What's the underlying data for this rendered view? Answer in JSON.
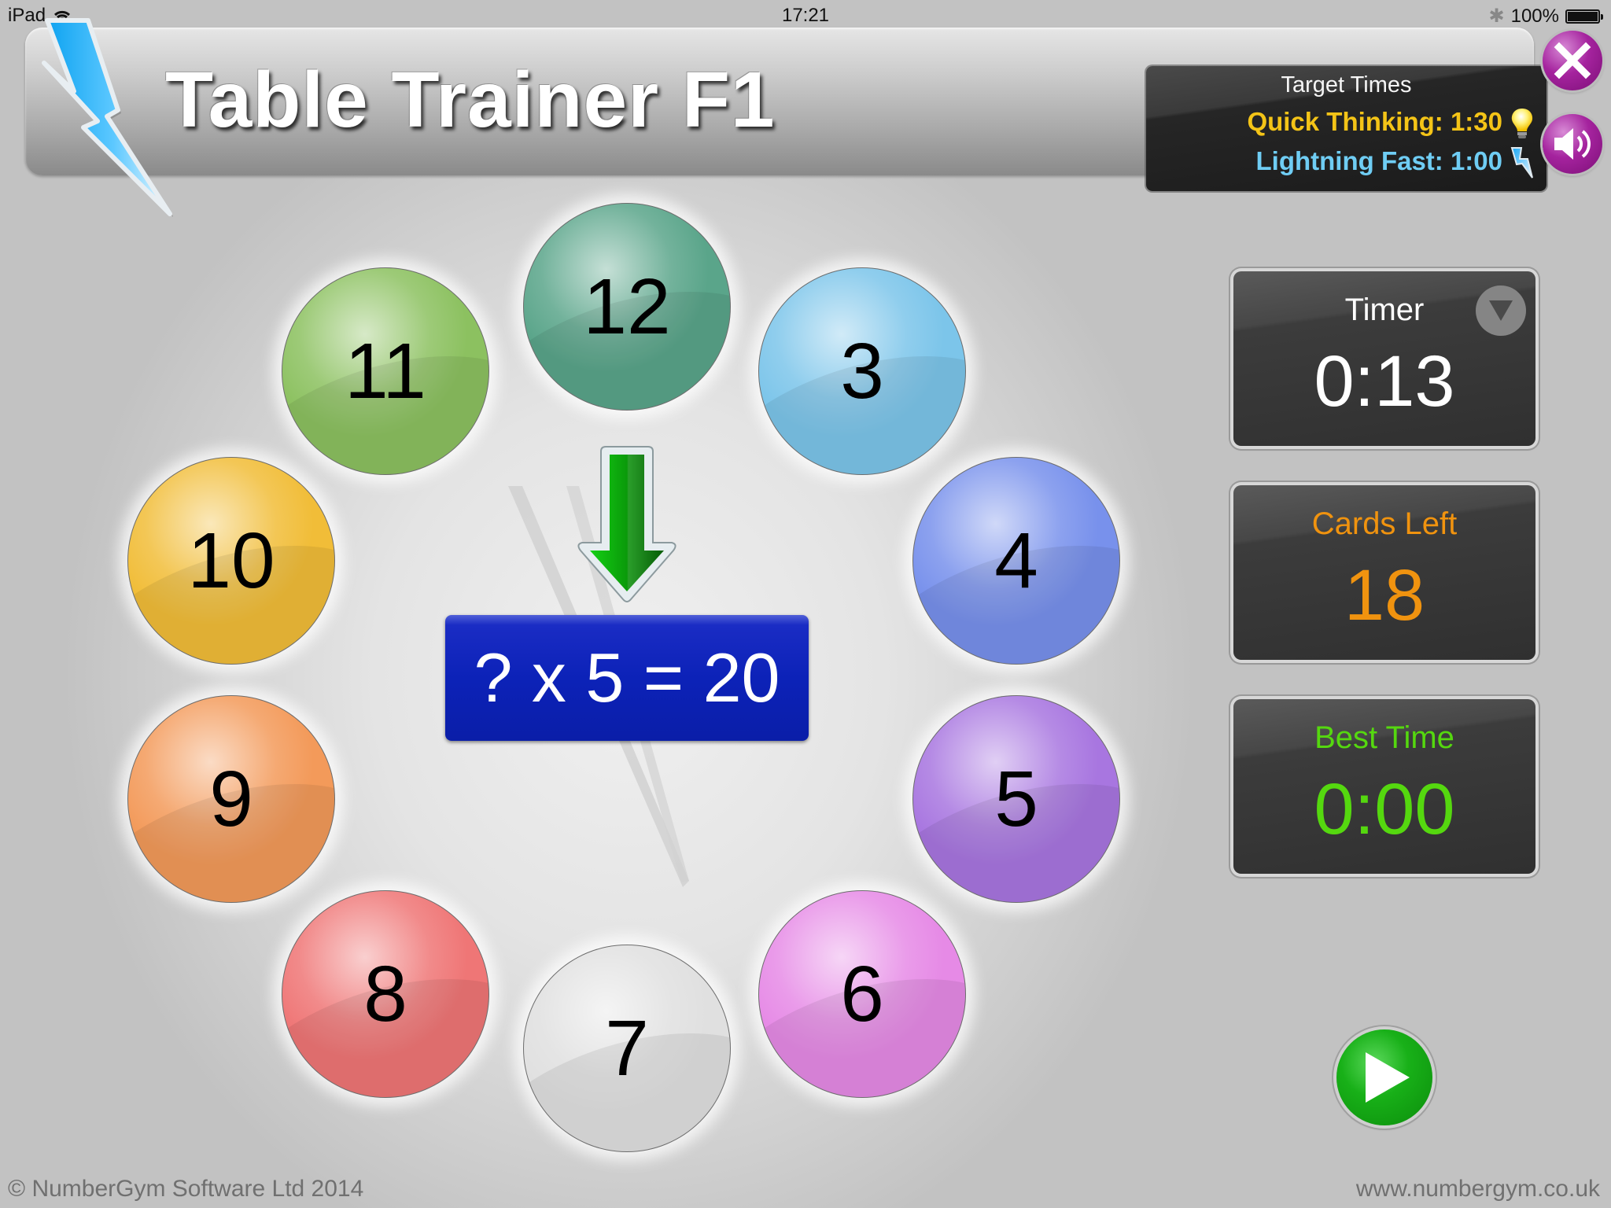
{
  "status_bar": {
    "device": "iPad",
    "time": "17:21",
    "battery": "100%",
    "icons": [
      "wifi-icon",
      "bluetooth-icon",
      "battery-icon"
    ]
  },
  "header": {
    "title": "Table Trainer F1",
    "logo_icon": "lightning-bolt-icon"
  },
  "target_times": {
    "title": "Target Times",
    "quick_thinking": "Quick Thinking: 1:30",
    "quick_icon": "light-bulb-icon",
    "lightning_fast": "Lightning Fast: 1:00",
    "fast_icon": "lightning-bolt-icon",
    "quick_color": "#f4c417",
    "fast_color": "#6fcdf4"
  },
  "buttons": {
    "close_icon": "close-icon",
    "sound_icon": "speaker-icon",
    "play_icon": "play-icon",
    "dropdown_icon": "triangle-down-icon"
  },
  "question": {
    "text": "? x 5 = 20",
    "pointer_icon": "arrow-down-icon"
  },
  "balls": [
    {
      "label": "12",
      "color": "#5aa58a"
    },
    {
      "label": "11",
      "color": "#8cc160"
    },
    {
      "label": "3",
      "color": "#7cc5ea"
    },
    {
      "label": "10",
      "color": "#f1bd38"
    },
    {
      "label": "4",
      "color": "#7891ec"
    },
    {
      "label": "9",
      "color": "#f39a5a"
    },
    {
      "label": "5",
      "color": "#a876e0"
    },
    {
      "label": "8",
      "color": "#ef7676"
    },
    {
      "label": "6",
      "color": "#e68ae6"
    },
    {
      "label": "7",
      "color": "#e0e0e0"
    }
  ],
  "panels": {
    "timer": {
      "label": "Timer",
      "value": "0:13",
      "color": "#ffffff"
    },
    "cards_left": {
      "label": "Cards Left",
      "value": "18",
      "color": "#f0930f"
    },
    "best_time": {
      "label": "Best Time",
      "value": "0:00",
      "color": "#55d80f"
    }
  },
  "footer": {
    "copyright": "© NumberGym Software Ltd 2014",
    "website": "www.numbergym.co.uk"
  }
}
